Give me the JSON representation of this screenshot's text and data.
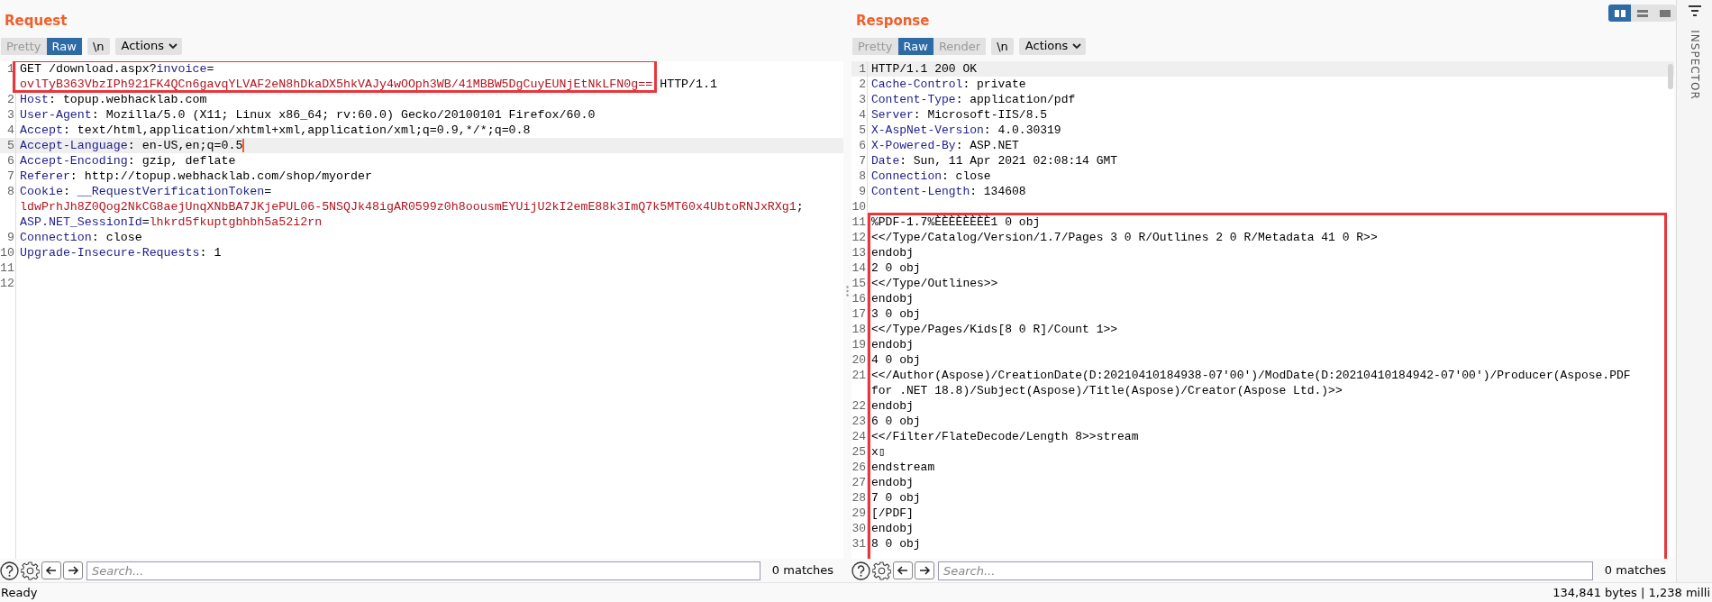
{
  "layout_buttons": [
    {
      "selected": true
    },
    {
      "selected": false
    },
    {
      "selected": false
    }
  ],
  "panels": [
    {
      "title": "Request",
      "view_tabs": [
        {
          "label": "Pretty",
          "selected": false
        },
        {
          "label": "Raw",
          "selected": true
        }
      ],
      "newline_button": "\\n",
      "actions_button": "Actions",
      "blocks": [
        {
          "boxed": true,
          "lines": [
            {
              "number": "1",
              "highlighted": false,
              "caret": false,
              "rows": [
                {
                  "parts": [
                    {
                      "kind": "plain",
                      "text": "GET /download.aspx?"
                    },
                    {
                      "kind": "key",
                      "text": "invoice"
                    },
                    {
                      "kind": "plain",
                      "text": "="
                    }
                  ]
                },
                {
                  "parts": [
                    {
                      "kind": "value",
                      "text": "ovlTyB363VbzIPh921FK4QCn6gavqYLVAF2eN8hDkaDX5hkVAJy4wOOph3WB/41MBBW5DgCuyEUNjEtNkLFN0g=="
                    },
                    {
                      "kind": "plain",
                      "text": " HTTP/1.1"
                    }
                  ]
                }
              ]
            }
          ]
        },
        {
          "boxed": false,
          "lines": [
            {
              "number": "2",
              "highlighted": false,
              "caret": false,
              "rows": [
                {
                  "parts": [
                    {
                      "kind": "key",
                      "text": "Host"
                    },
                    {
                      "kind": "plain",
                      "text": ": topup.webhacklab.com"
                    }
                  ]
                }
              ]
            },
            {
              "number": "3",
              "highlighted": false,
              "caret": false,
              "rows": [
                {
                  "parts": [
                    {
                      "kind": "key",
                      "text": "User-Agent"
                    },
                    {
                      "kind": "plain",
                      "text": ": Mozilla/5.0 (X11; Linux x86_64; rv:60.0) Gecko/20100101 Firefox/60.0"
                    }
                  ]
                }
              ]
            },
            {
              "number": "4",
              "highlighted": false,
              "caret": false,
              "rows": [
                {
                  "parts": [
                    {
                      "kind": "key",
                      "text": "Accept"
                    },
                    {
                      "kind": "plain",
                      "text": ": text/html,application/xhtml+xml,application/xml;q=0.9,*/*;q=0.8"
                    }
                  ]
                }
              ]
            },
            {
              "number": "5",
              "highlighted": true,
              "caret": true,
              "rows": [
                {
                  "parts": [
                    {
                      "kind": "key",
                      "text": "Accept-Language"
                    },
                    {
                      "kind": "plain",
                      "text": ": en-US,en;q=0.5"
                    }
                  ]
                }
              ]
            },
            {
              "number": "6",
              "highlighted": false,
              "caret": false,
              "rows": [
                {
                  "parts": [
                    {
                      "kind": "key",
                      "text": "Accept-Encoding"
                    },
                    {
                      "kind": "plain",
                      "text": ": gzip, deflate"
                    }
                  ]
                }
              ]
            },
            {
              "number": "7",
              "highlighted": false,
              "caret": false,
              "rows": [
                {
                  "parts": [
                    {
                      "kind": "key",
                      "text": "Referer"
                    },
                    {
                      "kind": "plain",
                      "text": ": http://topup.webhacklab.com/shop/myorder"
                    }
                  ]
                }
              ]
            },
            {
              "number": "8",
              "highlighted": false,
              "caret": false,
              "rows": [
                {
                  "parts": [
                    {
                      "kind": "key",
                      "text": "Cookie"
                    },
                    {
                      "kind": "plain",
                      "text": ": "
                    },
                    {
                      "kind": "key",
                      "text": "__RequestVerificationToken"
                    },
                    {
                      "kind": "plain",
                      "text": "="
                    }
                  ]
                },
                {
                  "parts": [
                    {
                      "kind": "value",
                      "text": "ldwPrhJh8Z0Qog2NkCG8aejUnqXNbBA7JKjePUL06-5NSQJk48igAR0599z0h8oousmEYUijU2kI2emE88k3ImQ7k5MT60x4UbtoRNJxRXg1"
                    },
                    {
                      "kind": "plain",
                      "text": ";"
                    }
                  ]
                },
                {
                  "parts": [
                    {
                      "kind": "key",
                      "text": "ASP.NET_SessionId"
                    },
                    {
                      "kind": "plain",
                      "text": "="
                    },
                    {
                      "kind": "value",
                      "text": "lhkrd5fkuptgbhbh5a52i2rn"
                    }
                  ]
                }
              ]
            },
            {
              "number": "9",
              "highlighted": false,
              "caret": false,
              "rows": [
                {
                  "parts": [
                    {
                      "kind": "key",
                      "text": "Connection"
                    },
                    {
                      "kind": "plain",
                      "text": ": close"
                    }
                  ]
                }
              ]
            },
            {
              "number": "10",
              "highlighted": false,
              "caret": false,
              "rows": [
                {
                  "parts": [
                    {
                      "kind": "key",
                      "text": "Upgrade-Insecure-Requests"
                    },
                    {
                      "kind": "plain",
                      "text": ": 1"
                    }
                  ]
                }
              ]
            },
            {
              "number": "11",
              "highlighted": false,
              "caret": false,
              "rows": [
                {}
              ]
            },
            {
              "number": "12",
              "highlighted": false,
              "caret": false,
              "rows": [
                {}
              ]
            }
          ]
        }
      ],
      "search": {
        "placeholder": "Search..."
      },
      "matches": "0 matches"
    },
    {
      "title": "Response",
      "view_tabs": [
        {
          "label": "Pretty",
          "selected": false
        },
        {
          "label": "Raw",
          "selected": true
        },
        {
          "label": "Render",
          "selected": false
        }
      ],
      "newline_button": "\\n",
      "actions_button": "Actions",
      "blocks": [
        {
          "boxed": false,
          "lines": [
            {
              "number": "1",
              "highlighted": true,
              "caret": false,
              "rows": [
                {
                  "parts": [
                    {
                      "kind": "plain",
                      "text": "HTTP/1.1 200 OK"
                    }
                  ]
                }
              ]
            },
            {
              "number": "2",
              "highlighted": false,
              "caret": false,
              "rows": [
                {
                  "parts": [
                    {
                      "kind": "key",
                      "text": "Cache-Control"
                    },
                    {
                      "kind": "plain",
                      "text": ": private"
                    }
                  ]
                }
              ]
            },
            {
              "number": "3",
              "highlighted": false,
              "caret": false,
              "rows": [
                {
                  "parts": [
                    {
                      "kind": "key",
                      "text": "Content-Type"
                    },
                    {
                      "kind": "plain",
                      "text": ": application/pdf"
                    }
                  ]
                }
              ]
            },
            {
              "number": "4",
              "highlighted": false,
              "caret": false,
              "rows": [
                {
                  "parts": [
                    {
                      "kind": "key",
                      "text": "Server"
                    },
                    {
                      "kind": "plain",
                      "text": ": Microsoft-IIS/8.5"
                    }
                  ]
                }
              ]
            },
            {
              "number": "5",
              "highlighted": false,
              "caret": false,
              "rows": [
                {
                  "parts": [
                    {
                      "kind": "key",
                      "text": "X-AspNet-Version"
                    },
                    {
                      "kind": "plain",
                      "text": ": 4.0.30319"
                    }
                  ]
                }
              ]
            },
            {
              "number": "6",
              "highlighted": false,
              "caret": false,
              "rows": [
                {
                  "parts": [
                    {
                      "kind": "key",
                      "text": "X-Powered-By"
                    },
                    {
                      "kind": "plain",
                      "text": ": ASP.NET"
                    }
                  ]
                }
              ]
            },
            {
              "number": "7",
              "highlighted": false,
              "caret": false,
              "rows": [
                {
                  "parts": [
                    {
                      "kind": "key",
                      "text": "Date"
                    },
                    {
                      "kind": "plain",
                      "text": ": Sun, 11 Apr 2021 02:08:14 GMT"
                    }
                  ]
                }
              ]
            },
            {
              "number": "8",
              "highlighted": false,
              "caret": false,
              "rows": [
                {
                  "parts": [
                    {
                      "kind": "key",
                      "text": "Connection"
                    },
                    {
                      "kind": "plain",
                      "text": ": close"
                    }
                  ]
                }
              ]
            },
            {
              "number": "9",
              "highlighted": false,
              "caret": false,
              "rows": [
                {
                  "parts": [
                    {
                      "kind": "key",
                      "text": "Content-Length"
                    },
                    {
                      "kind": "plain",
                      "text": ": 134608"
                    }
                  ]
                }
              ]
            },
            {
              "number": "10",
              "highlighted": false,
              "caret": false,
              "rows": [
                {}
              ]
            }
          ]
        },
        {
          "boxed": true,
          "lines": [
            {
              "number": "11",
              "highlighted": false,
              "caret": false,
              "rows": [
                {
                  "parts": [
                    {
                      "kind": "plain",
                      "text": "%PDF-1.7%ÈÈÈÈÈÈÈÈ1 0 obj"
                    }
                  ]
                }
              ]
            },
            {
              "number": "12",
              "highlighted": false,
              "caret": false,
              "rows": [
                {
                  "parts": [
                    {
                      "kind": "plain",
                      "text": "<</Type/Catalog/Version/1.7/Pages 3 0 R/Outlines 2 0 R/Metadata 41 0 R>>"
                    }
                  ]
                }
              ]
            },
            {
              "number": "13",
              "highlighted": false,
              "caret": false,
              "rows": [
                {
                  "parts": [
                    {
                      "kind": "plain",
                      "text": "endobj"
                    }
                  ]
                }
              ]
            },
            {
              "number": "14",
              "highlighted": false,
              "caret": false,
              "rows": [
                {
                  "parts": [
                    {
                      "kind": "plain",
                      "text": "2 0 obj"
                    }
                  ]
                }
              ]
            },
            {
              "number": "15",
              "highlighted": false,
              "caret": false,
              "rows": [
                {
                  "parts": [
                    {
                      "kind": "plain",
                      "text": "<</Type/Outlines>>"
                    }
                  ]
                }
              ]
            },
            {
              "number": "16",
              "highlighted": false,
              "caret": false,
              "rows": [
                {
                  "parts": [
                    {
                      "kind": "plain",
                      "text": "endobj"
                    }
                  ]
                }
              ]
            },
            {
              "number": "17",
              "highlighted": false,
              "caret": false,
              "rows": [
                {
                  "parts": [
                    {
                      "kind": "plain",
                      "text": "3 0 obj"
                    }
                  ]
                }
              ]
            },
            {
              "number": "18",
              "highlighted": false,
              "caret": false,
              "rows": [
                {
                  "parts": [
                    {
                      "kind": "plain",
                      "text": "<</Type/Pages/Kids[8 0 R]/Count 1>>"
                    }
                  ]
                }
              ]
            },
            {
              "number": "19",
              "highlighted": false,
              "caret": false,
              "rows": [
                {
                  "parts": [
                    {
                      "kind": "plain",
                      "text": "endobj"
                    }
                  ]
                }
              ]
            },
            {
              "number": "20",
              "highlighted": false,
              "caret": false,
              "rows": [
                {
                  "parts": [
                    {
                      "kind": "plain",
                      "text": "4 0 obj"
                    }
                  ]
                }
              ]
            },
            {
              "number": "21",
              "highlighted": false,
              "caret": false,
              "rows": [
                {
                  "parts": [
                    {
                      "kind": "plain",
                      "text": "<</Author(Aspose)/CreationDate(D:20210410184938-07'00')/ModDate(D:20210410184942-07'00')/Producer(Aspose.PDF"
                    }
                  ]
                },
                {
                  "parts": [
                    {
                      "kind": "plain",
                      "text": "for .NET 18.8)/Subject(Aspose)/Title(Aspose)/Creator(Aspose Ltd.)>>"
                    }
                  ]
                }
              ]
            },
            {
              "number": "22",
              "highlighted": false,
              "caret": false,
              "rows": [
                {
                  "parts": [
                    {
                      "kind": "plain",
                      "text": "endobj"
                    }
                  ]
                }
              ]
            },
            {
              "number": "23",
              "highlighted": false,
              "caret": false,
              "rows": [
                {
                  "parts": [
                    {
                      "kind": "plain",
                      "text": "6 0 obj"
                    }
                  ]
                }
              ]
            },
            {
              "number": "24",
              "highlighted": false,
              "caret": false,
              "rows": [
                {
                  "parts": [
                    {
                      "kind": "plain",
                      "text": "<</Filter/FlateDecode/Length 8>>stream"
                    }
                  ]
                }
              ]
            },
            {
              "number": "25",
              "highlighted": false,
              "caret": false,
              "rows": [
                {
                  "parts": [
                    {
                      "kind": "plain",
                      "text": "x▯"
                    }
                  ]
                }
              ]
            },
            {
              "number": "26",
              "highlighted": false,
              "caret": false,
              "rows": [
                {
                  "parts": [
                    {
                      "kind": "plain",
                      "text": "endstream"
                    }
                  ]
                }
              ]
            },
            {
              "number": "27",
              "highlighted": false,
              "caret": false,
              "rows": [
                {
                  "parts": [
                    {
                      "kind": "plain",
                      "text": "endobj"
                    }
                  ]
                }
              ]
            },
            {
              "number": "28",
              "highlighted": false,
              "caret": false,
              "rows": [
                {
                  "parts": [
                    {
                      "kind": "plain",
                      "text": "7 0 obj"
                    }
                  ]
                }
              ]
            },
            {
              "number": "29",
              "highlighted": false,
              "caret": false,
              "rows": [
                {
                  "parts": [
                    {
                      "kind": "plain",
                      "text": "[/PDF]"
                    }
                  ]
                }
              ]
            },
            {
              "number": "30",
              "highlighted": false,
              "caret": false,
              "rows": [
                {
                  "parts": [
                    {
                      "kind": "plain",
                      "text": "endobj"
                    }
                  ]
                }
              ]
            },
            {
              "number": "31",
              "highlighted": false,
              "caret": false,
              "rows": [
                {
                  "parts": [
                    {
                      "kind": "plain",
                      "text": "8 0 obj"
                    }
                  ]
                }
              ]
            }
          ]
        }
      ],
      "search": {
        "placeholder": "Search..."
      },
      "matches": "0 matches"
    }
  ],
  "inspector": {
    "label": "INSPECTOR"
  },
  "status_bar": {
    "left": "Ready",
    "right": "134,841 bytes | 1,238 milli"
  }
}
